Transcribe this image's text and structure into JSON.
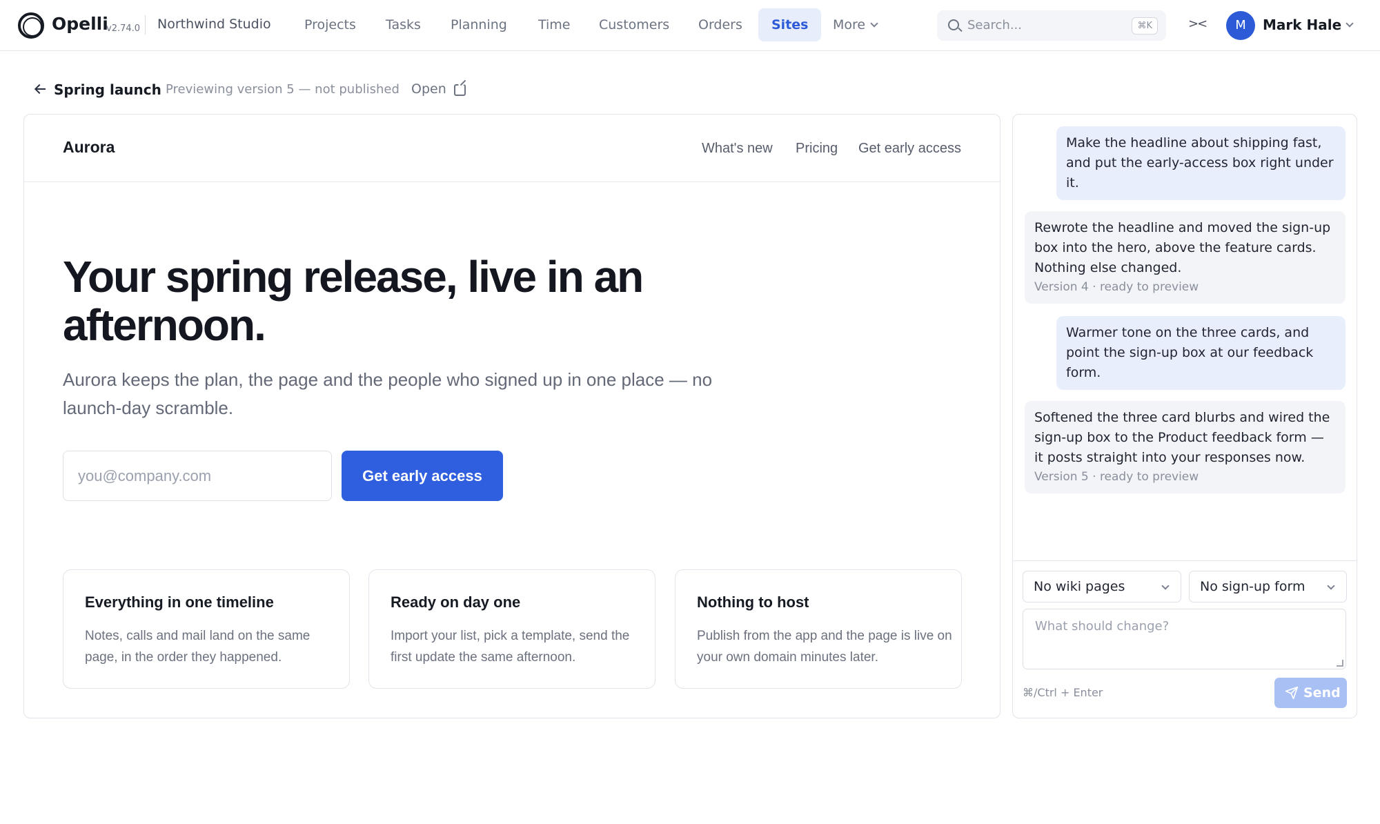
{
  "app": {
    "brand": "Opelli",
    "version": "v2.74.0",
    "workspace": "Northwind Studio"
  },
  "nav": {
    "items": [
      {
        "label": "Projects",
        "active": false
      },
      {
        "label": "Tasks",
        "active": false
      },
      {
        "label": "Planning",
        "active": false
      },
      {
        "label": "Time",
        "active": false
      },
      {
        "label": "Customers",
        "active": false
      },
      {
        "label": "Orders",
        "active": false
      },
      {
        "label": "Sites",
        "active": true
      },
      {
        "label": "More",
        "active": false
      }
    ],
    "search_placeholder": "Search...",
    "search_shortcut": "⌘K",
    "collapse_glyph": "><"
  },
  "user": {
    "initial": "M",
    "name": "Mark Hale"
  },
  "page": {
    "title": "Spring launch",
    "status": "Previewing version 5 — not published",
    "open_label": "Open"
  },
  "site": {
    "brand": "Aurora",
    "nav": [
      "What's new",
      "Pricing",
      "Get early access"
    ],
    "hero_title": "Your spring release, live in an afternoon.",
    "hero_subtitle": "Aurora keeps the plan, the page and the people who signed up in one place — no launch-day scramble.",
    "email_placeholder": "you@company.com",
    "cta_label": "Get early access",
    "features": [
      {
        "title": "Everything in one timeline",
        "text": "Notes, calls and mail land on the same page, in the order they happened."
      },
      {
        "title": "Ready on day one",
        "text": "Import your list, pick a template, send the first update the same afternoon."
      },
      {
        "title": "Nothing to host",
        "text": "Publish from the app and the page is live on your own domain minutes later."
      }
    ]
  },
  "chat": {
    "messages": [
      {
        "role": "user",
        "text": "Make the headline about shipping fast, and put the early-access box right under it."
      },
      {
        "role": "assistant",
        "text": "Rewrote the headline and moved the sign-up box into the hero, above the feature cards. Nothing else changed.",
        "meta": "Version 4 · ready to preview"
      },
      {
        "role": "user",
        "text": "Warmer tone on the three cards, and point the sign-up box at our feedback form."
      },
      {
        "role": "assistant",
        "text": "Softened the three card blurbs and wired the sign-up box to the Product feedback form — it posts straight into your responses now.",
        "meta": "Version 5 · ready to preview"
      }
    ],
    "wiki_select": "No wiki pages",
    "form_select": "No sign-up form",
    "input_placeholder": "What should change?",
    "shortcut_hint": "⌘/Ctrl + Enter",
    "send_label": "Send"
  },
  "colors": {
    "accent": "#2f5fdf",
    "nav_active_bg": "#e7edfb",
    "user_bubble": "#e8eefb",
    "assistant_bubble": "#f3f4f7",
    "send_disabled": "#a9c0f5"
  }
}
